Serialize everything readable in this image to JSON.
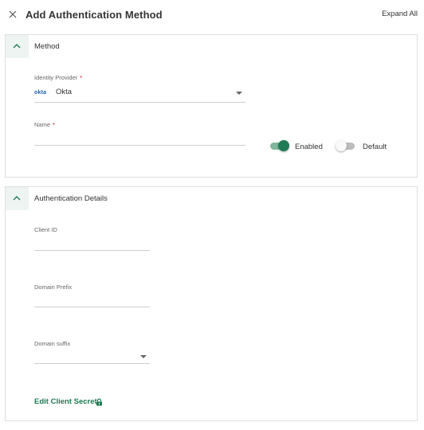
{
  "header": {
    "title": "Add Authentication Method",
    "expand_all": "Expand All"
  },
  "colors": {
    "accent": "#1e7b55",
    "required": "#d0021b",
    "panel_header_bg": "#eef4f1",
    "okta_brand": "#1a5fb4"
  },
  "method_panel": {
    "title": "Method",
    "identity_provider": {
      "label": "Identity Provider",
      "required": "*",
      "logo_text": "okta",
      "value": "Okta"
    },
    "name": {
      "label": "Name",
      "required": "*",
      "value": ""
    },
    "enabled_toggle": {
      "label": "Enabled",
      "on": true
    },
    "default_toggle": {
      "label": "Default",
      "on": false
    }
  },
  "auth_panel": {
    "title": "Authentication Details",
    "client_id": {
      "label": "Client ID",
      "value": ""
    },
    "domain_prefix": {
      "label": "Domain Prefix",
      "value": ""
    },
    "domain_suffix": {
      "label": "Domain suffix",
      "value": ""
    },
    "edit_client_secret": "Edit Client Secret"
  },
  "icons": {
    "close": "close-icon",
    "collapse": "chevron-up-icon",
    "dropdown": "caret-down-icon",
    "lock": "lock-icon"
  }
}
